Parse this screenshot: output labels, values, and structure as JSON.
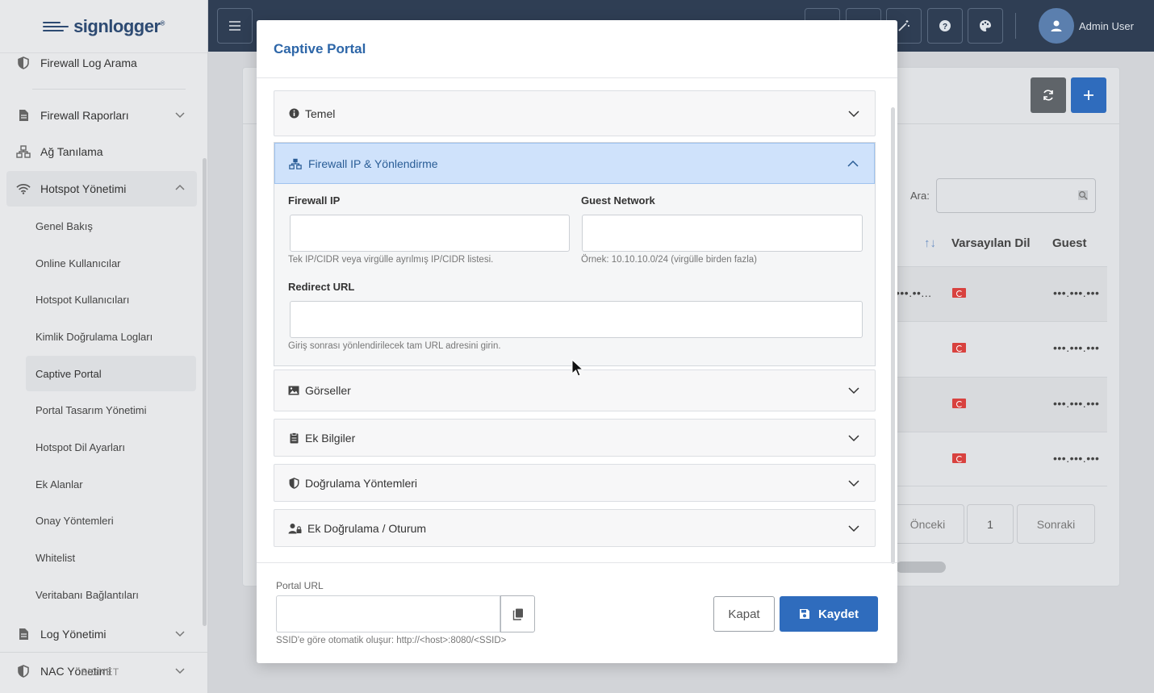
{
  "brand": {
    "name": "signlogger",
    "trademark": "®"
  },
  "sidebar": {
    "items": [
      {
        "label": "Firewall Log Arama",
        "icon": "shield-icon"
      },
      {
        "label": "Firewall Raporları",
        "icon": "file-icon"
      },
      {
        "label": "Ağ Tanılama",
        "icon": "network-icon"
      },
      {
        "label": "Hotspot Yönetimi",
        "icon": "wifi-icon",
        "expanded": true
      },
      {
        "label": "Log Yönetimi",
        "icon": "file-icon"
      },
      {
        "label": "NAC Yönetimi",
        "icon": "shield-icon"
      }
    ],
    "hotspot_sub": [
      "Genel Bakış",
      "Online Kullanıcılar",
      "Hotspot Kullanıcıları",
      "Kimlik Doğrulama Logları",
      "Captive Portal",
      "Portal Tasarım Yönetimi",
      "Hotspot Dil Ayarları",
      "Ek Alanlar",
      "Onay Yöntemleri",
      "Whitelist",
      "Veritabanı Bağlantıları"
    ],
    "active_sub": "Captive Portal",
    "footer_ghost": "SIGNET"
  },
  "topbar": {
    "user_name": "Admin User"
  },
  "background": {
    "search_label": "Ara:",
    "columns": [
      "Varsayılan Dil",
      "Guest"
    ],
    "sort_icon": "↑↓",
    "row_masked_left": "•••.••...",
    "row_masked_right": "•••.•••.•••",
    "pagination": {
      "prev": "Önceki",
      "page": "1",
      "next": "Sonraki"
    }
  },
  "modal": {
    "title": "Captive Portal",
    "sections": {
      "temel": "Temel",
      "firewall": "Firewall IP & Yönlendirme",
      "gorseller": "Görseller",
      "ek_bilgiler": "Ek Bilgiler",
      "dogrulama": "Doğrulama Yöntemleri",
      "ek_dogrulama": "Ek Doğrulama / Oturum"
    },
    "firewall_form": {
      "firewall_ip_label": "Firewall IP",
      "firewall_ip_value": "",
      "firewall_ip_help": "Tek IP/CIDR veya virgülle ayrılmış IP/CIDR listesi.",
      "guest_network_label": "Guest Network",
      "guest_network_value": "",
      "guest_network_help": "Örnek: 10.10.10.0/24 (virgülle birden fazla)",
      "redirect_url_label": "Redirect URL",
      "redirect_url_value": "",
      "redirect_url_help": "Giriş sonrası yönlendirilecek tam URL adresini girin."
    },
    "footer": {
      "portal_url_label": "Portal URL",
      "portal_url_value": "",
      "portal_url_help": "SSID'e göre otomatik oluşur: http://<host>:8080/<SSID>",
      "close_label": "Kapat",
      "save_label": "Kaydet"
    }
  },
  "colors": {
    "accent": "#2f6cbd",
    "topbar": "#2f3e54",
    "open_section": "#cfe2fb"
  }
}
